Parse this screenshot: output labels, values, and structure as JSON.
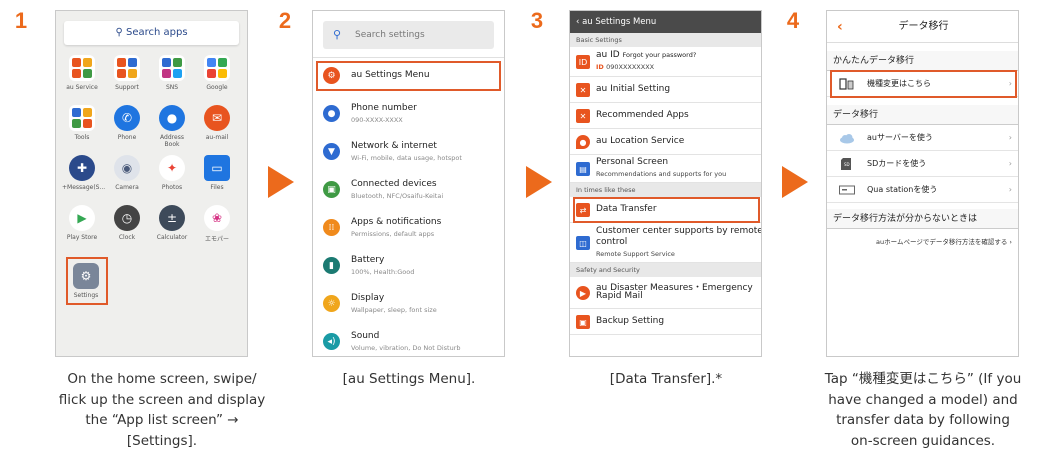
{
  "steps": [
    {
      "number": "1",
      "caption_lines": [
        "On the home screen, swipe/",
        "flick up the screen and display",
        "the “App list screen” →",
        "[Settings]."
      ]
    },
    {
      "number": "2",
      "caption_lines": [
        "[au Settings Menu]."
      ]
    },
    {
      "number": "3",
      "caption_lines": [
        "[Data Transfer].*"
      ]
    },
    {
      "number": "4",
      "caption_lines": [
        "Tap “機種変更はこちら” (If you",
        "have changed a model) and",
        "transfer data by following",
        "on-screen guidances."
      ]
    }
  ],
  "phone1": {
    "search_placeholder": "Search apps",
    "apps": [
      "au Service",
      "Support",
      "SNS",
      "Google",
      "Tools",
      "Phone",
      "Address Book",
      "au-mail",
      "+Message(S...",
      "Camera",
      "Photos",
      "Files",
      "Play Store",
      "Clock",
      "Calculator",
      "エモパー",
      "Settings"
    ]
  },
  "phone2": {
    "search_placeholder": "Search settings",
    "items": [
      {
        "title": "au Settings Menu",
        "subtitle": "",
        "color": "#e8541f"
      },
      {
        "title": "Phone number",
        "subtitle": "090-XXXX-XXXX",
        "color": "#2e6bd1"
      },
      {
        "title": "Network & internet",
        "subtitle": "Wi-Fi, mobile, data usage, hotspot",
        "color": "#2e6bd1"
      },
      {
        "title": "Connected devices",
        "subtitle": "Bluetooth, NFC/Osaifu-Keitai",
        "color": "#3f9a44"
      },
      {
        "title": "Apps & notifications",
        "subtitle": "Permissions, default apps",
        "color": "#f08a1c"
      },
      {
        "title": "Battery",
        "subtitle": "100%, Health:Good",
        "color": "#1b7a72"
      },
      {
        "title": "Display",
        "subtitle": "Wallpaper, sleep, font size",
        "color": "#f0a61c"
      },
      {
        "title": "Sound",
        "subtitle": "Volume, vibration, Do Not Disturb",
        "color": "#1a9ba5"
      }
    ]
  },
  "phone3": {
    "header": "‹ au Settings Menu",
    "sections": {
      "basic": "Basic Settings",
      "times": "In times like these",
      "safety": "Safety and Security"
    },
    "au_id_title": "au ID",
    "au_id_sub": "Forgot your password?",
    "au_id_num": "090XXXXXXXX",
    "initial_setting": "au Initial Setting",
    "recommended_apps": "Recommended Apps",
    "location_service": "au Location Service",
    "personal_screen": "Personal Screen",
    "personal_screen_sub": "Recommendations and supports for you",
    "data_transfer": "Data Transfer",
    "customer_center_1": "Customer center supports by remote",
    "customer_center_2": "control",
    "customer_center_sub": "Remote Support Service",
    "disaster_1": "au Disaster Measures・Emergency",
    "disaster_2": "Rapid Mail",
    "backup": "Backup Setting"
  },
  "phone4": {
    "back": "‹",
    "title": "データ移行",
    "section1": "かんたんデータ移行",
    "change_model": "機種変更はこちら",
    "section2": "データ移行",
    "rows": [
      "auサーバーを使う",
      "SDカードを使う",
      "Qua stationを使う"
    ],
    "section3": "データ移行方法が分からないときは",
    "help_link": "auホームページでデータ移行方法を確認する ›",
    "chevron": "›"
  }
}
